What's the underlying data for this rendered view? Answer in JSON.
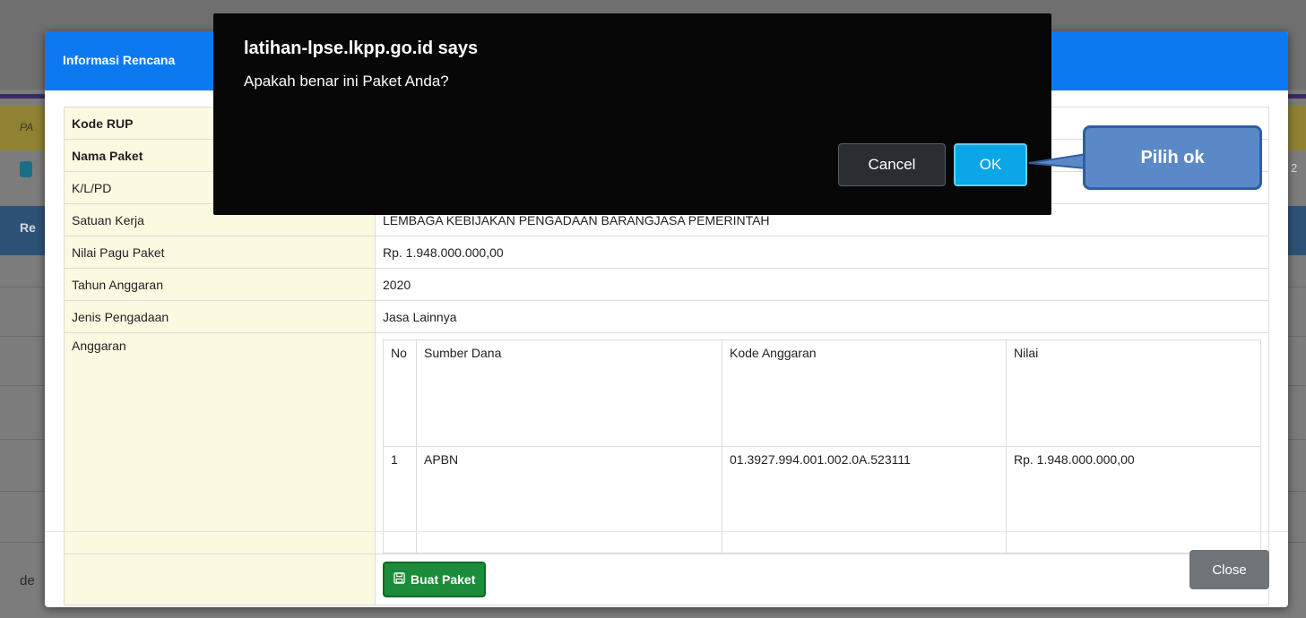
{
  "background": {
    "left_fragment_pa": "PA",
    "left_fragment_re": "Re",
    "left_fragment_de": "de",
    "right_fragment": "2"
  },
  "modal": {
    "title": "Informasi Rencana",
    "rows": [
      {
        "label": "Kode RUP",
        "value": "",
        "bold": true
      },
      {
        "label": "Nama Paket",
        "value": "",
        "bold": true
      },
      {
        "label": "K/L/PD",
        "value": ""
      },
      {
        "label": "Satuan Kerja",
        "value": "LEMBAGA KEBIJAKAN PENGADAAN BARANGJASA PEMERINTAH"
      },
      {
        "label": "Nilai Pagu Paket",
        "value": "Rp. 1.948.000.000,00"
      },
      {
        "label": "Tahun Anggaran",
        "value": "2020"
      },
      {
        "label": "Jenis Pengadaan",
        "value": "Jasa Lainnya"
      }
    ],
    "anggaran_label": "Anggaran",
    "anggaran_table": {
      "headers": [
        "No",
        "Sumber Dana",
        "Kode Anggaran",
        "Nilai"
      ],
      "rows": [
        [
          "1",
          "APBN",
          "01.3927.994.001.002.0A.523111",
          "Rp. 1.948.000.000,00"
        ]
      ]
    },
    "buat_paket_label": "Buat Paket",
    "close_label": "Close"
  },
  "alert": {
    "title": "latihan-lpse.lkpp.go.id says",
    "message": "Apakah benar ini Paket Anda?",
    "cancel_label": "Cancel",
    "ok_label": "OK"
  },
  "callout": {
    "text": "Pilih ok"
  },
  "colors": {
    "modal_header": "#0d79f0",
    "label_bg": "#fcf9e1",
    "buat_btn": "#1c8c3a",
    "ok_btn": "#0aa6e8",
    "callout_bg": "#5b89c8"
  },
  "icons": {
    "buat_paket_icon": "save-icon"
  }
}
